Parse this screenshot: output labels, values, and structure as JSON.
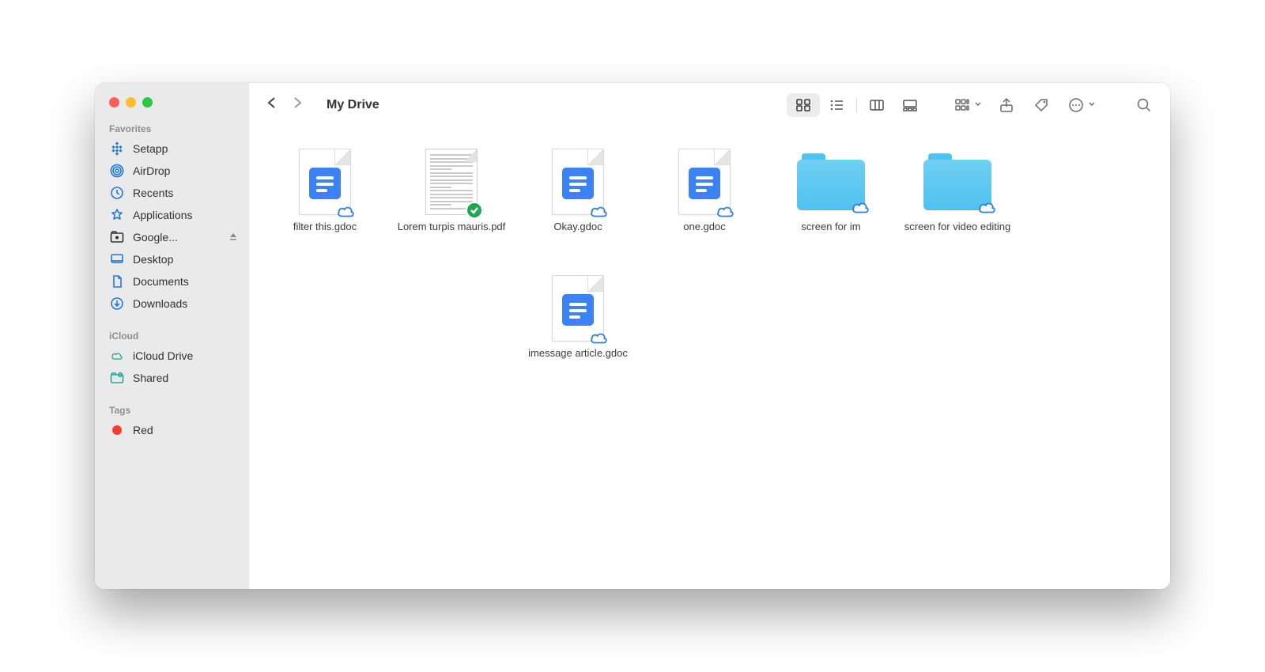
{
  "title": "My Drive",
  "sidebar": {
    "sections": [
      {
        "label": "Favorites",
        "items": [
          {
            "id": "setapp",
            "label": "Setapp",
            "icon": "setapp"
          },
          {
            "id": "airdrop",
            "label": "AirDrop",
            "icon": "airdrop"
          },
          {
            "id": "recents",
            "label": "Recents",
            "icon": "clock"
          },
          {
            "id": "applications",
            "label": "Applications",
            "icon": "apps"
          },
          {
            "id": "google",
            "label": "Google...",
            "icon": "camera",
            "selected": true,
            "ejectable": true
          },
          {
            "id": "desktop",
            "label": "Desktop",
            "icon": "desktop"
          },
          {
            "id": "documents",
            "label": "Documents",
            "icon": "doc"
          },
          {
            "id": "downloads",
            "label": "Downloads",
            "icon": "download-circle"
          }
        ]
      },
      {
        "label": "iCloud",
        "items": [
          {
            "id": "icloud-drive",
            "label": "iCloud Drive",
            "icon": "cloud"
          },
          {
            "id": "shared",
            "label": "Shared",
            "icon": "shared-folder"
          }
        ]
      },
      {
        "label": "Tags",
        "items": [
          {
            "id": "tag-red",
            "label": "Red",
            "icon": "tag-dot-red"
          }
        ]
      }
    ]
  },
  "files": [
    {
      "name": "filter this.gdoc",
      "type": "gdoc",
      "badge": "cloud"
    },
    {
      "name": "Lorem turpis mauris.pdf",
      "type": "pdf",
      "badge": "synced"
    },
    {
      "name": "Okay.gdoc",
      "type": "gdoc",
      "badge": "cloud"
    },
    {
      "name": "one.gdoc",
      "type": "gdoc",
      "badge": "cloud"
    },
    {
      "name": "screen for im",
      "type": "folder",
      "badge": "cloud"
    },
    {
      "name": "screen for video editing",
      "type": "folder",
      "badge": "cloud"
    },
    {
      "name": "imessage article.gdoc",
      "type": "gdoc",
      "badge": "cloud",
      "column": 3
    }
  ],
  "toolbar": {
    "view_mode": "icons"
  }
}
